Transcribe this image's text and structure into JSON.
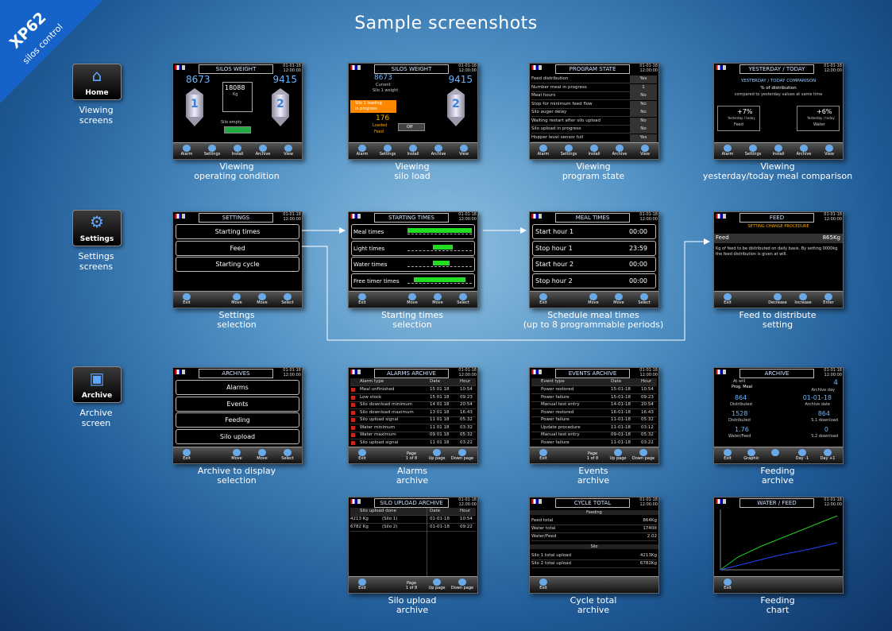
{
  "brand": {
    "model": "XP62",
    "sub": "silos control"
  },
  "page_title": "Sample screenshots",
  "categories": [
    {
      "label": "Home",
      "caption": "Viewing\nscreens",
      "icon": "home-icon"
    },
    {
      "label": "Settings",
      "caption": "Settings\nscreens",
      "icon": "settings-icon"
    },
    {
      "label": "Archive",
      "caption": "Archive\nscreen",
      "icon": "archive-icon"
    }
  ],
  "screens": {
    "op": {
      "title": "SILOS WEIGHT",
      "clock1": "01-01-18",
      "clock2": "12:00:00",
      "left": "8673",
      "right": "9415",
      "center": "18088",
      "unit": "Kg",
      "status": "Silo empty",
      "toolbar": [
        "Alarm",
        "Settings",
        "Install",
        "Archive",
        "View"
      ],
      "caption": "Viewing\noperating condition"
    },
    "load": {
      "title": "SILOS WEIGHT",
      "clock1": "01-01-18",
      "clock2": "12:00:00",
      "left": "8673",
      "right": "9415",
      "current": "Current",
      "sw": "Silo 1 weight",
      "loading1": "Silo 1 loading",
      "loading2": "in progress",
      "loaded": "176",
      "loadedlbl": "Loaded",
      "feed": "Feed",
      "off": "Off",
      "toolbar": [
        "Alarm",
        "Settings",
        "Install",
        "Archive",
        "View"
      ],
      "caption": "Viewing\nsilo load"
    },
    "prog": {
      "title": "PROGRAM STATE",
      "clock1": "01-01-18",
      "clock2": "12:00:00",
      "rows": [
        [
          "Feed distribution",
          "Yes"
        ],
        [
          "Number meal in progress",
          "1"
        ],
        [
          "Meal hours",
          "No"
        ],
        [
          "Stop for minimum feed flow",
          "No"
        ],
        [
          "Silo auger delay",
          "No"
        ],
        [
          "Waiting restart after silo upload",
          "No"
        ],
        [
          "Silo upload in progress",
          "No"
        ],
        [
          "Hopper level sensor full",
          "Yes"
        ]
      ],
      "toolbar": [
        "Alarm",
        "Settings",
        "Install",
        "Archive",
        "View"
      ],
      "caption": "Viewing\nprogram state"
    },
    "yest": {
      "title": "YESTERDAY / TODAY",
      "clock1": "01-01-18",
      "clock2": "12:00:00",
      "h1": "YESTERDAY / TODAY COMPARISON",
      "h2": "% of distribution",
      "h3": "compared to yesterday values at same time",
      "v1": "+7%",
      "v2": "+6%",
      "l1": "Yesterday / today",
      "l2": "Yesterday / today",
      "f": "Feed",
      "w": "Water",
      "toolbar": [
        "Alarm",
        "Settings",
        "Install",
        "Archive",
        "View"
      ],
      "caption": "Viewing\nyesterday/today meal comparison"
    },
    "settings": {
      "title": "SETTINGS",
      "clock1": "01-01-18",
      "clock2": "12:00:00",
      "items": [
        "Starting times",
        "Feed",
        "Starting cycle"
      ],
      "toolbar": [
        "Exit",
        "Move",
        "Move",
        "Select"
      ],
      "caption": "Settings\nselection"
    },
    "start": {
      "title": "STARTING TIMES",
      "clock1": "01-01-18",
      "clock2": "12:00:00",
      "items": [
        "Meal times",
        "Light times",
        "Water times",
        "Free timer times"
      ],
      "toolbar": [
        "Exit",
        "Move",
        "Move",
        "Select"
      ],
      "caption": "Starting times\nselection"
    },
    "meal": {
      "title": "MEAL TIMES",
      "clock1": "01-01-18",
      "clock2": "12:00:00",
      "items": [
        [
          "Start hour 1",
          "00:00"
        ],
        [
          "Stop hour 1",
          "23:59"
        ],
        [
          "Start hour 2",
          "00:00"
        ],
        [
          "Stop hour 2",
          "00:00"
        ]
      ],
      "toolbar": [
        "Exit",
        "Move",
        "Move",
        "Select"
      ],
      "caption": "Schedule meal times\n(up to 8 programmable periods)"
    },
    "feed": {
      "title": "FEED",
      "clock1": "01-01-18",
      "clock2": "12:00:00",
      "sub": "SETTING CHANGE PROCEDURE",
      "label": "Feed",
      "value": "865Kg",
      "desc": "Kg of feed to be distributed on daily basis. By setting 0000kg the feed distribution is given at will.",
      "toolbar": [
        "Exit",
        "Decrease",
        "Increase",
        "Enter"
      ],
      "caption": "Feed to distribute\nsetting"
    },
    "arch": {
      "title": "ARCHIVES",
      "clock1": "01-01-18",
      "clock2": "12:00:00",
      "items": [
        "Alarms",
        "Events",
        "Feeding",
        "Silo upload"
      ],
      "toolbar": [
        "Exit",
        "Move",
        "Move",
        "Select"
      ],
      "caption": "Archive to display\nselection"
    },
    "alarms": {
      "title": "ALARMS ARCHIVE",
      "clock1": "01-01-18",
      "clock2": "12:00:00",
      "cols": [
        "Alarm type",
        "Date",
        "Hour"
      ],
      "rows": [
        [
          "Meal unfinished",
          "15 01 18",
          "10:54"
        ],
        [
          "Low stock",
          "15 01 18",
          "09:23"
        ],
        [
          "Silo download minimum",
          "14 01 18",
          "20:54"
        ],
        [
          "Silo download maximum",
          "13 01 18",
          "16:43"
        ],
        [
          "Silo upload signal",
          "11 01 18",
          "05:32"
        ],
        [
          "Water minimum",
          "11 01 18",
          "03:32"
        ],
        [
          "Water maximum",
          "09 01 18",
          "05:32"
        ],
        [
          "Silo upload signal",
          "11 01 18",
          "03:22"
        ]
      ],
      "page": "Page\n1 of 8",
      "toolbar": [
        "Exit",
        "Up page",
        "Down page"
      ],
      "caption": "Alarms\narchive"
    },
    "events": {
      "title": "EVENTS ARCHIVE",
      "clock1": "01-01-18",
      "clock2": "12:00:00",
      "cols": [
        "Event type",
        "Date",
        "Hour"
      ],
      "rows": [
        [
          "Power restored",
          "15-01-18",
          "10:54"
        ],
        [
          "Power failure",
          "15-01-18",
          "09:23"
        ],
        [
          "Manual test entry",
          "14-01-18",
          "20:54"
        ],
        [
          "Power restored",
          "16-01-18",
          "16:43"
        ],
        [
          "Power failure",
          "11-01-18",
          "05:32"
        ],
        [
          "Update procedure",
          "11-01-18",
          "03:12"
        ],
        [
          "Manual test entry",
          "09-01-18",
          "05:32"
        ],
        [
          "Power failure",
          "11-01-18",
          "03:22"
        ]
      ],
      "page": "Page\n1 of 8",
      "toolbar": [
        "Exit",
        "Up page",
        "Down page"
      ],
      "caption": "Events\narchive"
    },
    "feeding": {
      "title": "ARCHIVE",
      "clock1": "01-01-18",
      "clock2": "12:00:00",
      "a1": "At will",
      "a2": "Prog. Meal",
      "day": "4",
      "daylbl": "Archive day",
      "d1": "864",
      "d1l": "Distributed",
      "date": "01-01-18",
      "datel": "Archive date",
      "w": "1528",
      "wl": "Distributed",
      "s1": "864",
      "s1l": "S.1 download",
      "r": "1.76",
      "rl": "Water/Feed",
      "s2": "0",
      "s2l": "S.2 download",
      "toolbar": [
        "Exit",
        "Graphic",
        "",
        "Day -1",
        "Day +1"
      ],
      "caption": "Feeding\narchive"
    },
    "siloup": {
      "title": "SILO UPLOAD ARCHIVE",
      "clock1": "01-01-18",
      "clock2": "12:00:00",
      "cols": [
        "Silo upload done",
        "Date",
        "Hour"
      ],
      "rows": [
        [
          "4213 Kg",
          "(Silo 1)",
          "01-01-18",
          "10:54"
        ],
        [
          "6782 Kg",
          "(Silo 2)",
          "01-01-18",
          "09:22"
        ]
      ],
      "page": "Page\n1 of 8",
      "toolbar": [
        "Exit",
        "Up page",
        "Down page"
      ],
      "caption": "Silo upload\narchive"
    },
    "cycle": {
      "title": "CYCLE TOTAL",
      "clock1": "01-01-18",
      "clock2": "12:00:00",
      "s1": "Feeding",
      "rows1": [
        [
          "Feed total",
          "864Kg"
        ],
        [
          "Water total",
          "1740lt"
        ],
        [
          "Water/Feed",
          "2.02"
        ]
      ],
      "s2": "Silo",
      "rows2": [
        [
          "Silo 1 total upload",
          "4213Kg"
        ],
        [
          "Silo 2 total upload",
          "6782Kg"
        ]
      ],
      "toolbar": [
        "Exit"
      ],
      "caption": "Cycle total\narchive"
    },
    "chart": {
      "title": "WATER / FEED",
      "clock1": "01-01-18",
      "clock2": "12:00:00",
      "toolbar": [
        "Exit"
      ],
      "caption": "Feeding\nchart"
    }
  }
}
